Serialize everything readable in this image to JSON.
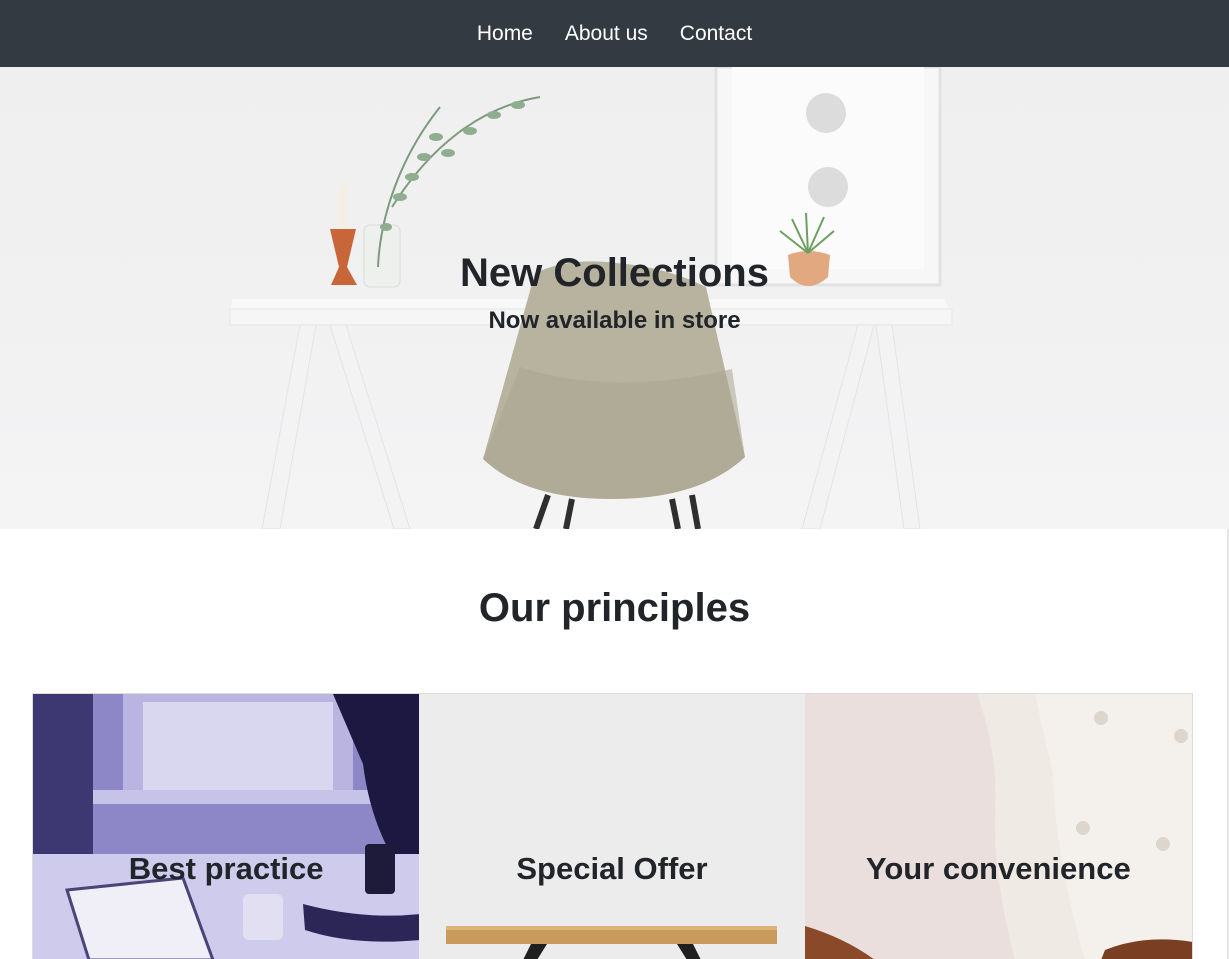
{
  "nav": {
    "items": [
      {
        "label": "Home"
      },
      {
        "label": "About us"
      },
      {
        "label": "Contact"
      }
    ]
  },
  "hero": {
    "title": "New Collections",
    "subtitle": "Now available in store"
  },
  "principles": {
    "title": "Our principles",
    "cards": [
      {
        "title": "Best practice"
      },
      {
        "title": "Special Offer"
      },
      {
        "title": "Your convenience"
      }
    ]
  },
  "colors": {
    "navbar": "#333a42",
    "text": "#212529",
    "card_tint": "#8c86c8",
    "card_gray": "#ececec",
    "card_pink": "#eadfdc"
  }
}
